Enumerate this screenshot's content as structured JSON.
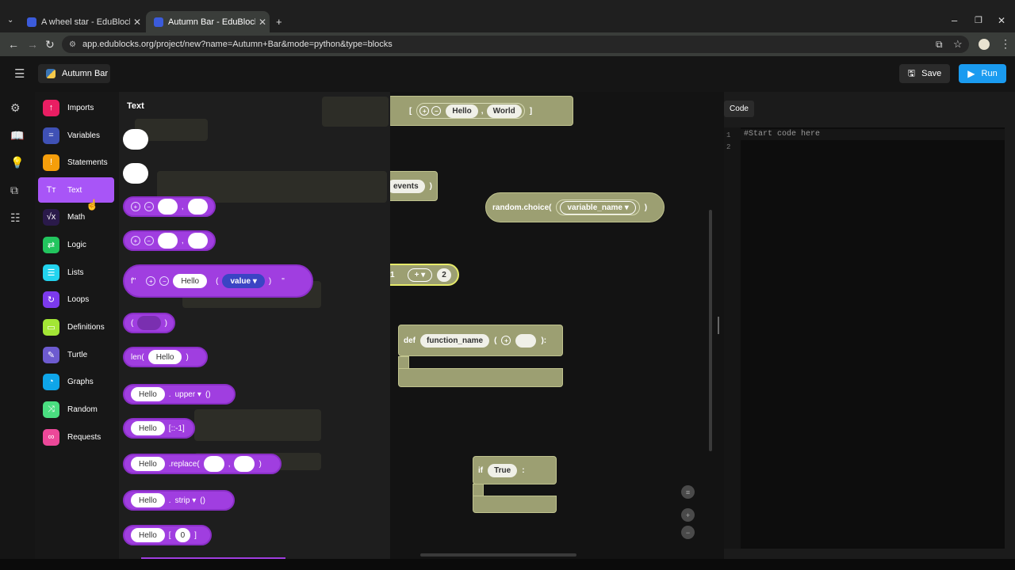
{
  "browser": {
    "tabs": [
      {
        "title": "A wheel star - EduBlocks",
        "close": "✕"
      },
      {
        "title": "Autumn Bar - EduBlocks",
        "close": "✕"
      }
    ],
    "new_tab": "+",
    "url": "app.edublocks.org/project/new?name=Autumn+Bar&mode=python&type=blocks"
  },
  "app": {
    "project_name": "Autumn Bar",
    "save_label": "Save",
    "run_label": "Run"
  },
  "categories": [
    {
      "label": "Imports",
      "color": "#e91e63"
    },
    {
      "label": "Variables",
      "color": "#3f51b5"
    },
    {
      "label": "Statements",
      "color": "#f59e0b"
    },
    {
      "label": "Text",
      "color": "#a855f7"
    },
    {
      "label": "Math",
      "color": "#2a1a4a"
    },
    {
      "label": "Logic",
      "color": "#22c55e"
    },
    {
      "label": "Lists",
      "color": "#22d3ee"
    },
    {
      "label": "Loops",
      "color": "#7c3aed"
    },
    {
      "label": "Definitions",
      "color": "#a3e635"
    },
    {
      "label": "Turtle",
      "color": "#6d5bd0"
    },
    {
      "label": "Graphs",
      "color": "#0ea5e9"
    },
    {
      "label": "Random",
      "color": "#4ade80"
    },
    {
      "label": "Requests",
      "color": "#ec4899"
    }
  ],
  "flyout": {
    "title": "Text",
    "f_prefix": "f\"",
    "f_suffix": "\"",
    "hello": "Hello",
    "value": "value",
    "len": "len(",
    "upper": "upper",
    "reverse": "[::-1]",
    "replace": ".replace(",
    "strip": "strip",
    "index": "0",
    "dot": ".",
    "comma": ",",
    "call": "()"
  },
  "workspace": {
    "list_items": [
      "Hello",
      "World"
    ],
    "events": "events",
    "random_choice": "random.choice(",
    "variable_name": "variable_name",
    "num_a": "1",
    "op": "+",
    "num_b": "2",
    "def_kw": "def",
    "function_name": "function_name",
    "colon": "):",
    "if_kw": "if",
    "true_val": "True",
    "if_colon": ":"
  },
  "code": {
    "tab": "Code",
    "line_numbers": [
      "1",
      "2"
    ],
    "line1": "#Start code here"
  }
}
